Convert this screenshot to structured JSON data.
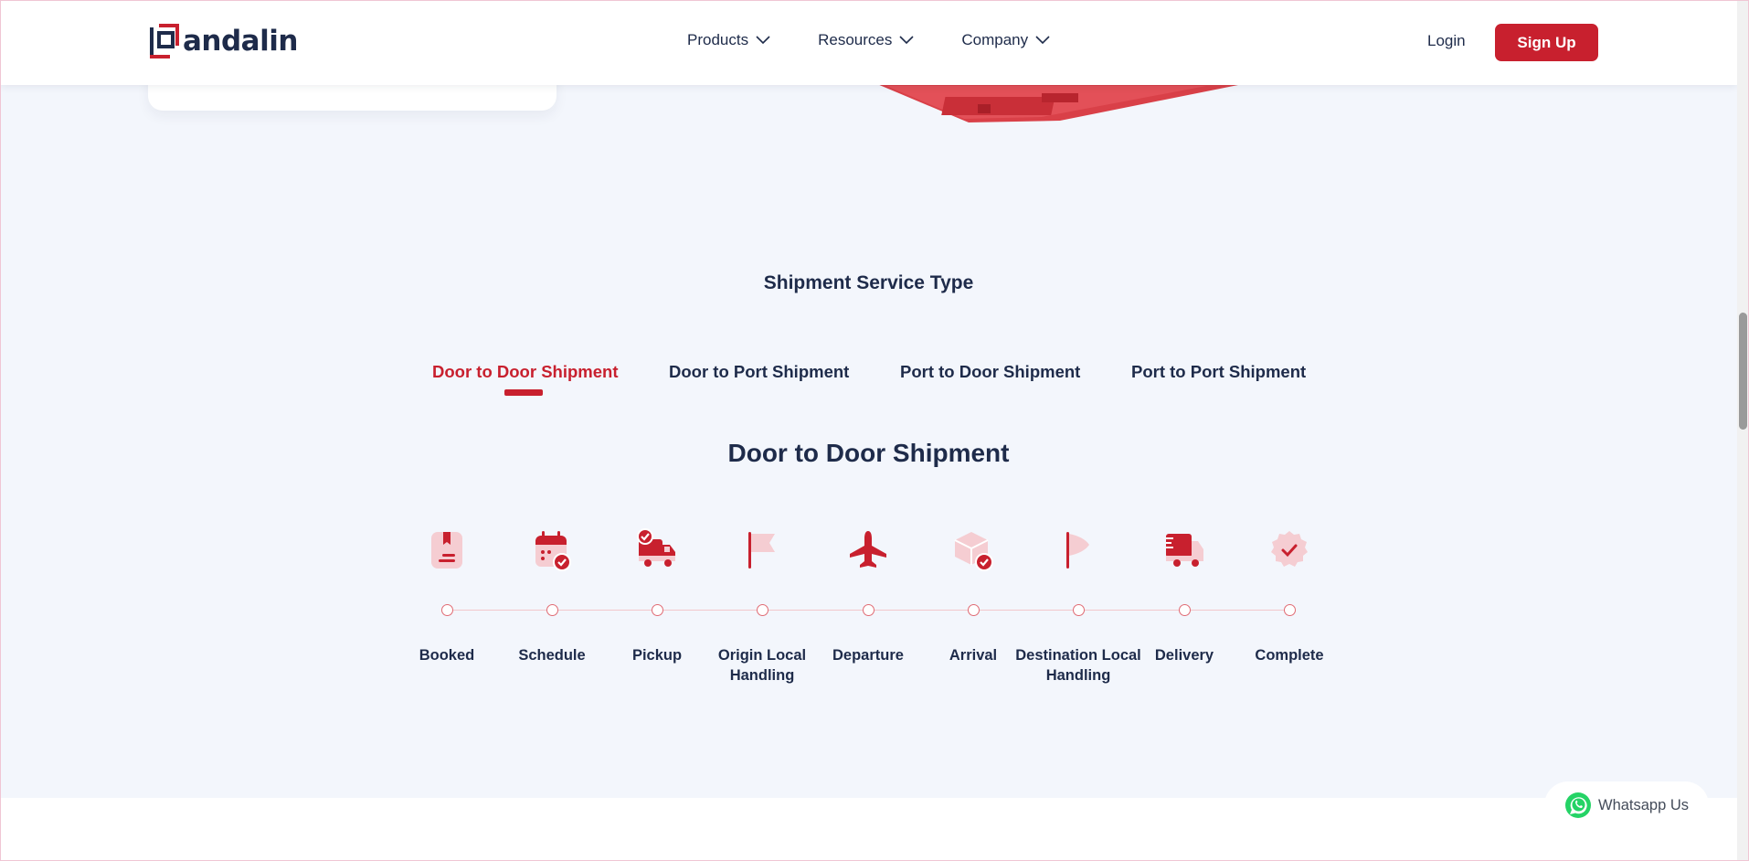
{
  "brand": {
    "name": "andalin",
    "accent": "#c8202e",
    "text": "#1e2b4a"
  },
  "nav": {
    "items": [
      {
        "label": "Products",
        "icon": "chevron-down-icon"
      },
      {
        "label": "Resources",
        "icon": "chevron-down-icon"
      },
      {
        "label": "Company",
        "icon": "chevron-down-icon"
      }
    ],
    "login": "Login",
    "signup": "Sign Up"
  },
  "section": {
    "title": "Shipment Service Type",
    "tabs": [
      {
        "label": "Door to Door Shipment",
        "active": true
      },
      {
        "label": "Door to Port Shipment",
        "active": false
      },
      {
        "label": "Port to Door Shipment",
        "active": false
      },
      {
        "label": "Port to Port Shipment",
        "active": false
      }
    ],
    "subtitle": "Door to Door Shipment",
    "steps": [
      {
        "label": "Booked",
        "icon": "booking-icon"
      },
      {
        "label": "Schedule",
        "icon": "calendar-check-icon"
      },
      {
        "label": "Pickup",
        "icon": "pickup-truck-icon"
      },
      {
        "label": "Origin Local Handling",
        "icon": "flag-icon"
      },
      {
        "label": "Departure",
        "icon": "airplane-icon"
      },
      {
        "label": "Arrival",
        "icon": "box-check-icon"
      },
      {
        "label": "Destination Local Handling",
        "icon": "flag-outline-icon"
      },
      {
        "label": "Delivery",
        "icon": "delivery-truck-icon"
      },
      {
        "label": "Complete",
        "icon": "badge-check-icon"
      }
    ]
  },
  "whatsapp": {
    "label": "Whatsapp Us",
    "icon": "whatsapp-icon"
  }
}
